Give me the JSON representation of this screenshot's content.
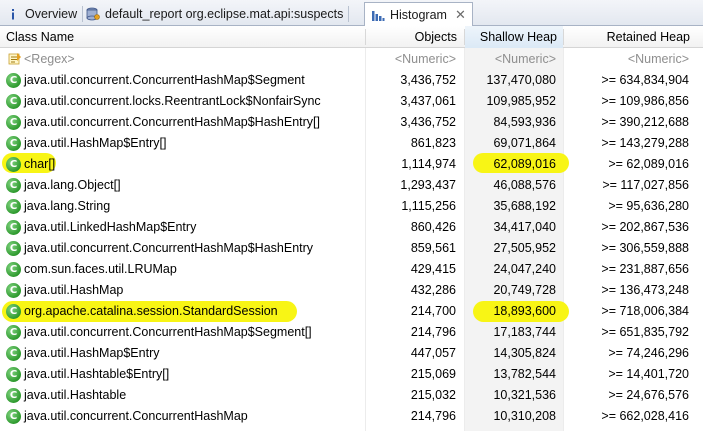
{
  "tabs": [
    {
      "label": "Overview",
      "icon": "info-icon"
    },
    {
      "label": "default_report  org.eclipse.mat.api:suspects",
      "icon": "report-database-icon"
    },
    {
      "label": "Histogram",
      "icon": "histogram-icon",
      "close": "✕"
    }
  ],
  "columns": {
    "class_name": "Class Name",
    "objects": "Objects",
    "shallow_heap": "Shallow Heap",
    "retained_heap": "Retained Heap"
  },
  "filter": {
    "class_name": "<Regex>",
    "objects": "<Numeric>",
    "shallow_heap": "<Numeric>",
    "retained_heap": "<Numeric>"
  },
  "highlight_color": "#f8f515",
  "rows": [
    {
      "name": "java.util.concurrent.ConcurrentHashMap$Segment",
      "objects": "3,436,752",
      "shallow": "137,470,080",
      "retained": ">= 634,834,904"
    },
    {
      "name": "java.util.concurrent.locks.ReentrantLock$NonfairSync",
      "objects": "3,437,061",
      "shallow": "109,985,952",
      "retained": ">= 109,986,856"
    },
    {
      "name": "java.util.concurrent.ConcurrentHashMap$HashEntry[]",
      "objects": "3,436,752",
      "shallow": "84,593,936",
      "retained": ">= 390,212,688"
    },
    {
      "name": "java.util.HashMap$Entry[]",
      "objects": "861,823",
      "shallow": "69,071,864",
      "retained": ">= 143,279,288"
    },
    {
      "name": "char[]",
      "objects": "1,114,974",
      "shallow": "62,089,016",
      "retained": ">= 62,089,016"
    },
    {
      "name": "java.lang.Object[]",
      "objects": "1,293,437",
      "shallow": "46,088,576",
      "retained": ">= 117,027,856"
    },
    {
      "name": "java.lang.String",
      "objects": "1,115,256",
      "shallow": "35,688,192",
      "retained": ">= 95,636,280"
    },
    {
      "name": "java.util.LinkedHashMap$Entry",
      "objects": "860,426",
      "shallow": "34,417,040",
      "retained": ">= 202,867,536"
    },
    {
      "name": "java.util.concurrent.ConcurrentHashMap$HashEntry",
      "objects": "859,561",
      "shallow": "27,505,952",
      "retained": ">= 306,559,888"
    },
    {
      "name": "com.sun.faces.util.LRUMap",
      "objects": "429,415",
      "shallow": "24,047,240",
      "retained": ">= 231,887,656"
    },
    {
      "name": "java.util.HashMap",
      "objects": "432,286",
      "shallow": "20,749,728",
      "retained": ">= 136,473,248"
    },
    {
      "name": "org.apache.catalina.session.StandardSession",
      "objects": "214,700",
      "shallow": "18,893,600",
      "retained": ">= 718,006,384"
    },
    {
      "name": "java.util.concurrent.ConcurrentHashMap$Segment[]",
      "objects": "214,796",
      "shallow": "17,183,744",
      "retained": ">= 651,835,792"
    },
    {
      "name": "java.util.HashMap$Entry",
      "objects": "447,057",
      "shallow": "14,305,824",
      "retained": ">= 74,246,296"
    },
    {
      "name": "java.util.Hashtable$Entry[]",
      "objects": "215,069",
      "shallow": "13,782,544",
      "retained": ">= 14,401,720"
    },
    {
      "name": "java.util.Hashtable",
      "objects": "215,032",
      "shallow": "10,321,536",
      "retained": ">= 24,676,576"
    },
    {
      "name": "java.util.concurrent.ConcurrentHashMap",
      "objects": "214,796",
      "shallow": "10,310,208",
      "retained": ">= 662,028,416"
    }
  ],
  "class_icon_letter": "C"
}
